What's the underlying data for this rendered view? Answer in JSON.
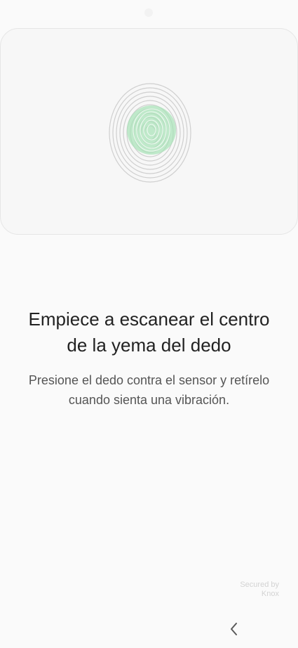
{
  "screen": {
    "title_line1": "Empiece a escanear el centro",
    "title_line2": "de la yema del dedo",
    "subtitle_line1": "Presione el dedo contra el sensor y retírelo",
    "subtitle_line2": "cuando sienta una vibración."
  },
  "badge": {
    "line1": "Secured by",
    "line2": "Knox"
  },
  "navigation": {
    "back_icon": "chevron-left-icon"
  },
  "colors": {
    "accent_green": "#a6e3b7",
    "background": "#fafafa",
    "card": "#f7f7f7"
  },
  "icons": {
    "fingerprint": "fingerprint-icon"
  }
}
